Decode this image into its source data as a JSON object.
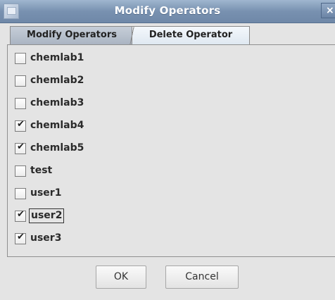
{
  "window": {
    "title": "Modify Operators",
    "close_label": "×"
  },
  "tabs": [
    {
      "label": "Modify Operators",
      "selected": false
    },
    {
      "label": "Delete Operator",
      "selected": true
    }
  ],
  "operators": [
    {
      "name": "chemlab1",
      "checked": false
    },
    {
      "name": "chemlab2",
      "checked": false
    },
    {
      "name": "chemlab3",
      "checked": false
    },
    {
      "name": "chemlab4",
      "checked": true
    },
    {
      "name": "chemlab5",
      "checked": true
    },
    {
      "name": "test",
      "checked": false
    },
    {
      "name": "user1",
      "checked": false
    },
    {
      "name": "user2",
      "checked": true,
      "focused": true
    },
    {
      "name": "user3",
      "checked": true
    }
  ],
  "check_glyph": "✔",
  "buttons": {
    "ok_label": "OK",
    "cancel_label": "Cancel"
  }
}
